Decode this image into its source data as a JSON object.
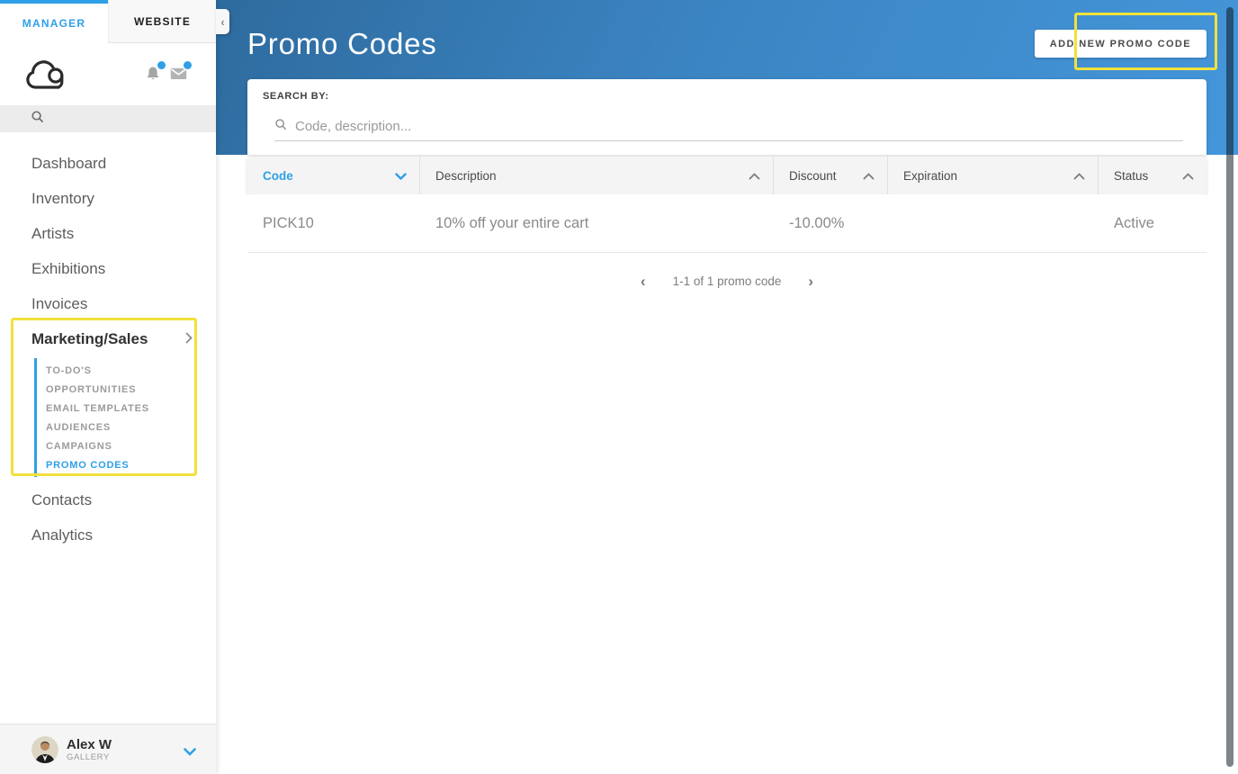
{
  "colors": {
    "accent_blue": "#2f9fe8",
    "highlight_yellow": "#f2e13c",
    "header_gradient_start": "#2e6b9e",
    "header_gradient_end": "#4496da",
    "sidebar_text": "#5d5d5d",
    "row_text": "#8a8a8a"
  },
  "icons": {
    "chevron_left": "‹",
    "chevron_right": "›",
    "collapse_chevron": "‹"
  },
  "sidebar": {
    "tabs": [
      {
        "label": "MANAGER",
        "active": true
      },
      {
        "label": "WEBSITE",
        "active": false
      }
    ],
    "nav": [
      "Dashboard",
      "Inventory",
      "Artists",
      "Exhibitions",
      "Invoices"
    ],
    "marketing": {
      "label": "Marketing/Sales",
      "items": [
        "TO-DO'S",
        "OPPORTUNITIES",
        "EMAIL TEMPLATES",
        "AUDIENCES",
        "CAMPAIGNS",
        "PROMO CODES"
      ],
      "active_item": "PROMO CODES"
    },
    "nav_after": [
      "Contacts",
      "Analytics"
    ],
    "user": {
      "name": "Alex W",
      "role": "GALLERY"
    }
  },
  "header": {
    "title": "Promo Codes",
    "add_button_label": "ADD NEW PROMO CODE"
  },
  "search": {
    "label": "SEARCH BY:",
    "placeholder": "Code, description..."
  },
  "table": {
    "columns": [
      {
        "label": "Code",
        "sort": "desc",
        "active": true
      },
      {
        "label": "Description",
        "sort": "asc",
        "active": false
      },
      {
        "label": "Discount",
        "sort": "asc",
        "active": false
      },
      {
        "label": "Expiration",
        "sort": "asc",
        "active": false
      },
      {
        "label": "Status",
        "sort": "asc",
        "active": false
      }
    ],
    "rows": [
      {
        "code": "PICK10",
        "description": "10% off your entire cart",
        "discount": "-10.00%",
        "expiration": "",
        "status": "Active"
      }
    ]
  },
  "pagination": {
    "label": "1-1 of 1 promo code"
  }
}
